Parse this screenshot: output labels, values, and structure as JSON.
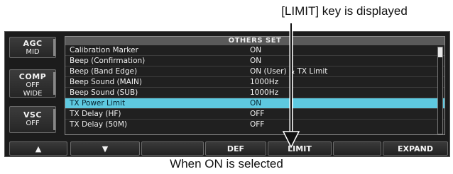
{
  "captions": {
    "top": "[LIMIT] key is displayed",
    "bottom": "When ON is selected"
  },
  "side_buttons": [
    {
      "title": "AGC",
      "values": [
        "MID"
      ]
    },
    {
      "title": "COMP",
      "values": [
        "OFF",
        "WIDE"
      ]
    },
    {
      "title": "VSC",
      "values": [
        "OFF"
      ]
    }
  ],
  "panel": {
    "title": "OTHERS SET",
    "rows": [
      {
        "name": "Calibration Marker",
        "value": "ON"
      },
      {
        "name": "Beep (Confirmation)",
        "value": "ON"
      },
      {
        "name": "Beep (Band Edge)",
        "value": "ON (User) & TX Limit"
      },
      {
        "name": "Beep Sound (MAIN)",
        "value": "1000Hz"
      },
      {
        "name": "Beep Sound (SUB)",
        "value": "1000Hz"
      },
      {
        "name": "TX Power Limit",
        "value": "ON"
      },
      {
        "name": "TX Delay (HF)",
        "value": "OFF"
      },
      {
        "name": "TX Delay (50M)",
        "value": "OFF"
      }
    ],
    "selected_index": 5
  },
  "keys": {
    "up": "▲",
    "down": "▼",
    "blank1": "",
    "def": "DEF",
    "limit": "LIMIT",
    "blank2": "",
    "expand": "EXPAND"
  },
  "colors": {
    "selection": "#5ec9e0",
    "screen_bg": "#1c1c1c"
  }
}
